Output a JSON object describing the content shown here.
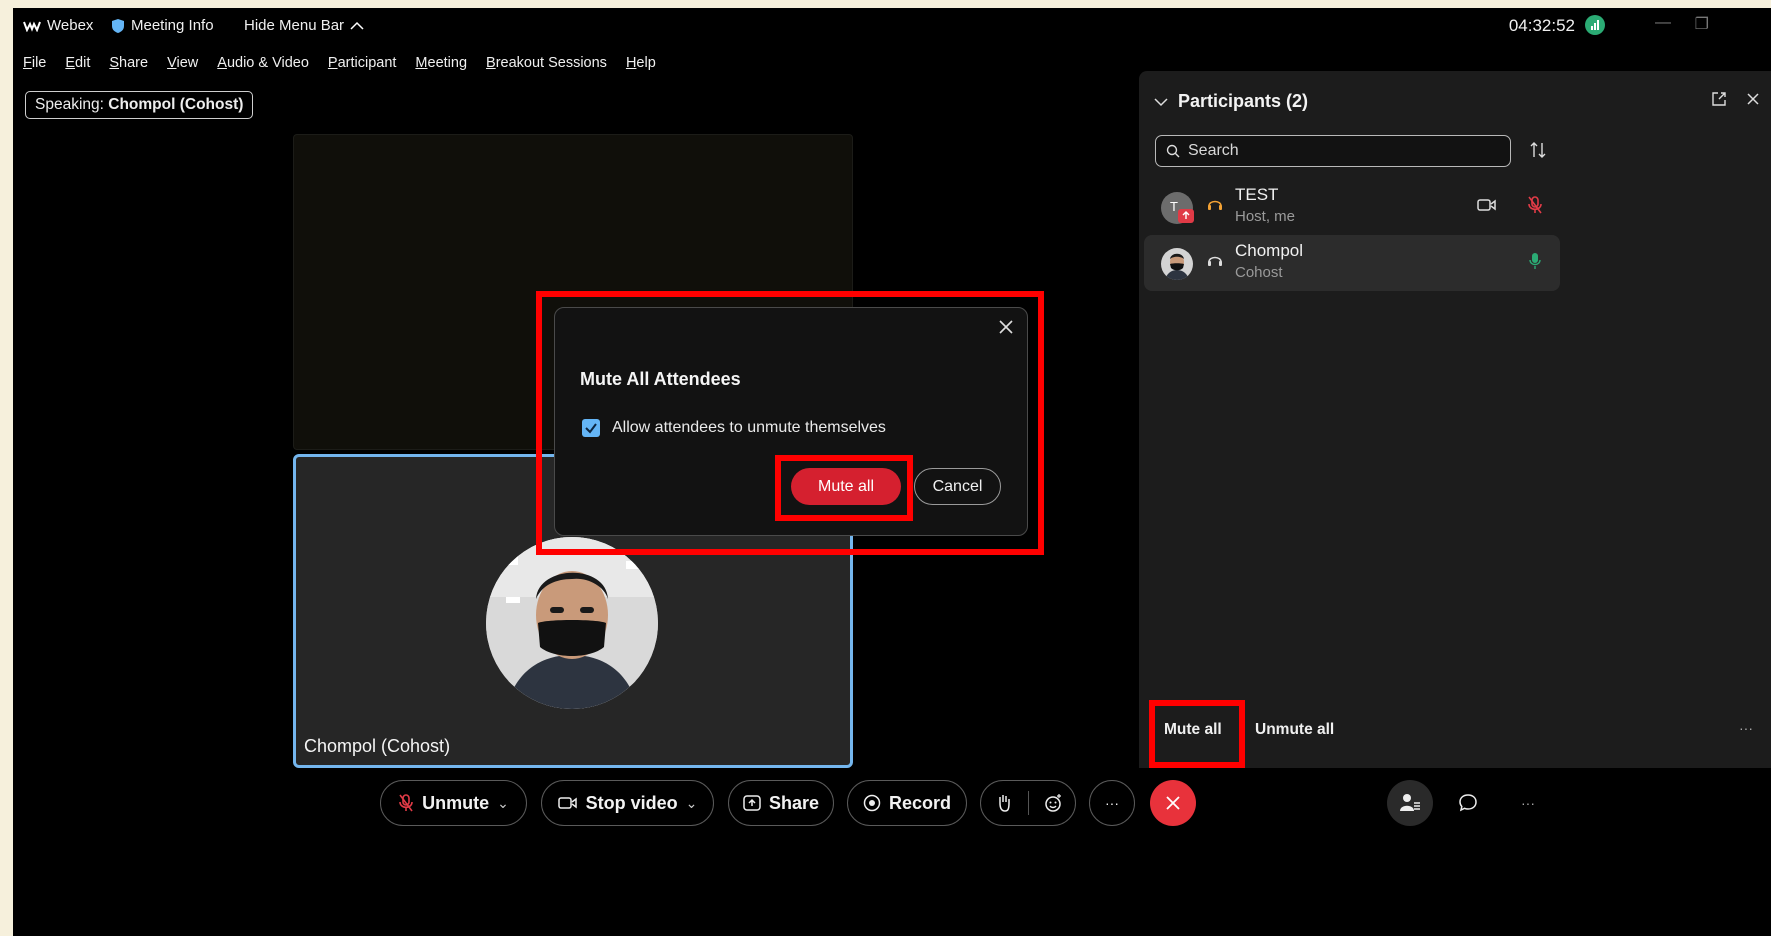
{
  "topbar": {
    "app_name": "Webex",
    "meeting_info": "Meeting Info",
    "hide_menu_bar": "Hide Menu Bar",
    "clock": "04:32:52"
  },
  "menubar": [
    "File",
    "Edit",
    "Share",
    "View",
    "Audio & Video",
    "Participant",
    "Meeting",
    "Breakout Sessions",
    "Help"
  ],
  "speaking": {
    "prefix": "Speaking:",
    "name": "Chompol (Cohost)"
  },
  "video": {
    "tile_name": "Chompol (Cohost)"
  },
  "dialog": {
    "title": "Mute All Attendees",
    "checkbox_label": "Allow attendees to unmute themselves",
    "checkbox_checked": true,
    "confirm_label": "Mute all",
    "cancel_label": "Cancel"
  },
  "participants": {
    "title": "Participants (2)",
    "search_placeholder": "Search",
    "list": [
      {
        "name": "TEST",
        "role": "Host, me",
        "avatar_initial": "T",
        "muted": true,
        "video": true
      },
      {
        "name": "Chompol",
        "role": "Cohost",
        "muted": false,
        "video": false
      }
    ],
    "mute_all_label": "Mute all",
    "unmute_all_label": "Unmute all"
  },
  "controls": {
    "unmute_label": "Unmute",
    "stop_video_label": "Stop video",
    "share_label": "Share",
    "record_label": "Record"
  },
  "colors": {
    "accent_blue": "#74b6ee",
    "danger_red": "#d5202f",
    "signal_green": "#2bab74",
    "highlight_red": "#ff0000"
  }
}
